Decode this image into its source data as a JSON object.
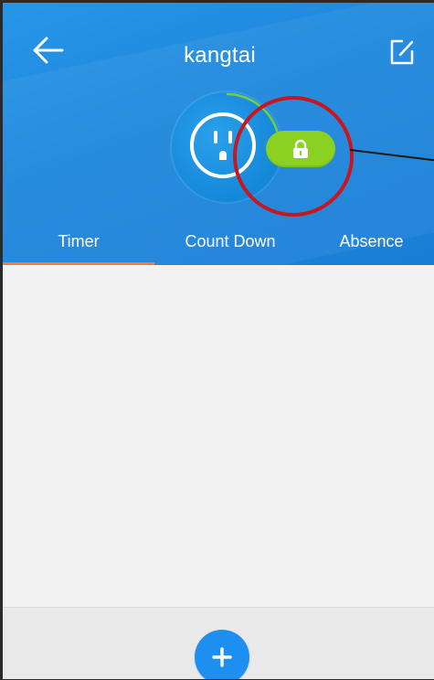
{
  "header": {
    "title": "kangtai",
    "back_icon": "arrow-left-icon",
    "edit_icon": "edit-icon",
    "device_icon": "power-socket-icon",
    "lock_icon": "lock-icon",
    "lock_toggle_color": "#8bd121",
    "background_color": "#1d86dc"
  },
  "tabs": {
    "items": [
      {
        "label": "Timer",
        "active": true
      },
      {
        "label": "Count Down",
        "active": false
      },
      {
        "label": "Absence",
        "active": false
      }
    ],
    "indicator_color": "#ff7a2a"
  },
  "fab": {
    "icon": "plus-icon",
    "color": "#1d8ff0"
  },
  "annotation": {
    "circle_color": "#c9151d"
  }
}
